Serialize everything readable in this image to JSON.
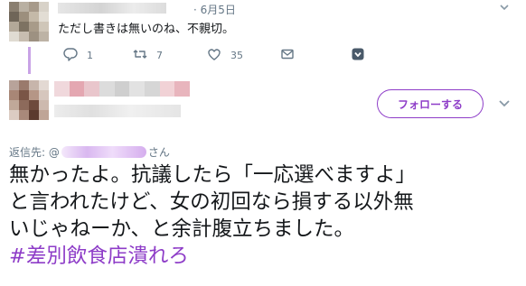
{
  "parent_tweet": {
    "date": "· 6月5日",
    "text": "ただし書きは無いのね、不親切。",
    "actions": {
      "reply_count": "1",
      "retweet_count": "7",
      "like_count": "35"
    }
  },
  "reply_tweet": {
    "follow_label": "フォローする",
    "replying_to_prefix": "返信先: @",
    "replying_to_suffix": "さん",
    "body_lines": [
      "無かったよ。抗議したら「一応選べますよ」",
      "と言われたけど、女の初回なら損する以外無",
      "いじゃねーか、と余計腹立ちました。"
    ],
    "hashtag": "#差別飲食店潰れろ"
  },
  "colors": {
    "accent": "#8e3dc8",
    "muted": "#657786",
    "text": "#14171a",
    "thread_line": "#c9a3e6"
  },
  "icons": {
    "reply": "reply-icon",
    "retweet": "retweet-icon",
    "like": "heart-icon",
    "dm": "envelope-icon",
    "extra": "extension-shield-icon",
    "caret": "chevron-down-icon"
  }
}
